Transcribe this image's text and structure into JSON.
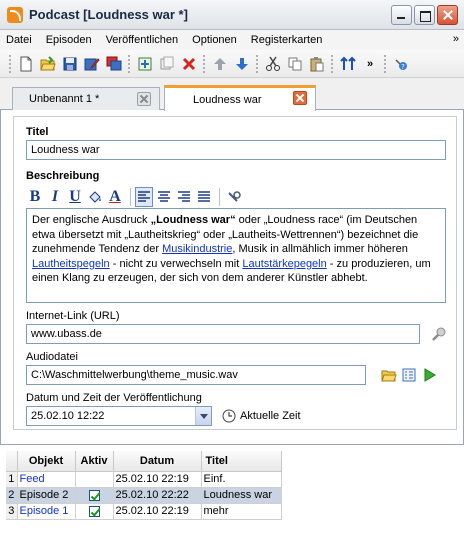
{
  "window": {
    "title": "Podcast [Loudness war *]"
  },
  "menu": {
    "items": [
      "Datei",
      "Episoden",
      "Veröffentlichen",
      "Optionen",
      "Registerkarten"
    ],
    "more": "»"
  },
  "toolbar": {
    "icons": [
      "new-file-icon",
      "open-folder-icon",
      "save-icon",
      "edit-icon",
      "copy-window-icon",
      "add-icon",
      "duplicate-icon",
      "delete-icon",
      "up-arrow-icon",
      "down-arrow-icon",
      "cut-icon",
      "copy-icon",
      "paste-icon",
      "sort-icon",
      "more-icon",
      "help-icon"
    ],
    "more": "»"
  },
  "tabs": [
    {
      "label": "Unbenannt 1 *",
      "active": false
    },
    {
      "label": "Loudness war",
      "active": true
    }
  ],
  "form": {
    "title_label": "Titel",
    "title_value": "Loudness war",
    "description_label": "Beschreibung",
    "description": {
      "p1_pre": "Der englische Ausdruck ",
      "p1_bold": "„Loudness war“",
      "p1_post": " oder „Loudness race“ (im Deutschen etwa übersetzt mit „Lautheitskrieg“ oder „Lautheits-Wettrennen“) bezeichnet die zunehmende Tendenz der ",
      "link1": "Musikindustrie",
      "p2": ", Musik in allmählich immer höheren ",
      "link2": "Lautheitspegeln",
      "p3": " - nicht zu verwechseln mit ",
      "link3": "Lautstärkepegeln",
      "p4": " - zu produzieren, um einen Klang zu erzeugen, der sich von dem anderer Künstler abhebt."
    },
    "url_label": "Internet-Link (URL)",
    "url_value": "www.ubass.de",
    "audio_label": "Audiodatei",
    "audio_value": "C:\\Waschmittelwerbung\\theme_music.wav",
    "date_label": "Datum und Zeit der Veröffentlichung",
    "date_value": "25.02.10 12:22",
    "current_time_label": "Aktuelle Zeit"
  },
  "table": {
    "headers": [
      "Objekt",
      "Aktiv",
      "Datum",
      "Titel"
    ],
    "rows": [
      {
        "num": "1",
        "objekt": "Feed",
        "aktiv": false,
        "aktiv_shown": false,
        "datum": "25.02.10 22:19",
        "titel": "Einf.",
        "selected": false
      },
      {
        "num": "2",
        "objekt": "Episode 2",
        "aktiv": true,
        "aktiv_shown": true,
        "datum": "25.02.10 22:22",
        "titel": "Loudness war",
        "selected": true
      },
      {
        "num": "3",
        "objekt": "Episode 1",
        "aktiv": true,
        "aktiv_shown": true,
        "datum": "25.02.10 22:19",
        "titel": "mehr",
        "selected": false
      }
    ]
  }
}
